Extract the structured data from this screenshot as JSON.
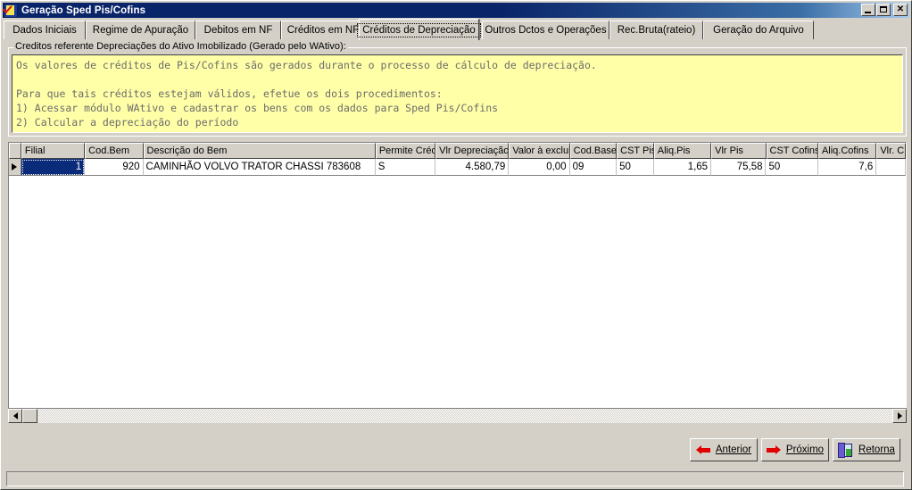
{
  "window": {
    "title": "Geração Sped Pis/Cofins",
    "icon": "checkmark-icon",
    "minimize_label": "_",
    "maximize_label": "□",
    "close_label": "✕"
  },
  "tabs": [
    {
      "label": "Dados Iniciais",
      "active": false
    },
    {
      "label": "Regime de Apuração",
      "active": false
    },
    {
      "label": "Debitos em NF",
      "active": false
    },
    {
      "label": "Créditos em NF",
      "active": false
    },
    {
      "label": "Créditos de Depreciação",
      "active": true
    },
    {
      "label": "Outros Dctos e Operações",
      "active": false
    },
    {
      "label": "Rec.Bruta(rateio)",
      "active": false
    },
    {
      "label": "Geração do Arquivo",
      "active": false
    }
  ],
  "groupbox": {
    "label": "Creditos referente Depreciações do Ativo Imobilizado (Gerado pelo WAtivo):",
    "memo_text": "Os valores de créditos de Pis/Cofins são gerados durante o processo de cálculo de depreciação.\n\nPara que tais créditos estejam válidos, efetue os dois procedimentos:\n1) Acessar módulo WAtivo e cadastrar os bens com os dados para Sped Pis/Cofins\n2) Calcular a depreciação do período",
    "memo_background": "#ffffa8",
    "memo_text_color": "#6b6b6b"
  },
  "grid": {
    "columns": [
      {
        "header": "Filial",
        "align": "right"
      },
      {
        "header": "Cod.Bem",
        "align": "right"
      },
      {
        "header": "Descrição do Bem",
        "align": "left"
      },
      {
        "header": "Permite Créd.",
        "align": "left"
      },
      {
        "header": "Vlr Depreciação",
        "align": "right"
      },
      {
        "header": "Valor à excluir",
        "align": "right"
      },
      {
        "header": "Cod.Base",
        "align": "left"
      },
      {
        "header": "CST Pis",
        "align": "left"
      },
      {
        "header": "Aliq.Pis",
        "align": "right"
      },
      {
        "header": "Vlr Pis",
        "align": "right"
      },
      {
        "header": "CST Cofins",
        "align": "left"
      },
      {
        "header": "Aliq.Cofins",
        "align": "right"
      },
      {
        "header": "Vlr. C",
        "align": "right"
      }
    ],
    "rows": [
      {
        "filial": "1",
        "cod_bem": "920",
        "descricao": "CAMINHÃO VOLVO TRATOR CHASSI 783608",
        "permite_cred": "S",
        "vlr_depreciacao": "4.580,79",
        "valor_excluir": "0,00",
        "cod_base": "09",
        "cst_pis": "50",
        "aliq_pis": "1,65",
        "vlr_pis": "75,58",
        "cst_cofins": "50",
        "aliq_cofins": "7,6",
        "vlr_cofins": "",
        "selected_cell": "filial"
      }
    ],
    "selection_color": "#0a2a7a"
  },
  "buttons": {
    "anterior": {
      "label_pre": "A",
      "label_mnemonic": "A",
      "label": "Anterior",
      "icon": "arrow-left-icon"
    },
    "proximo": {
      "label": "Próximo",
      "icon": "arrow-right-icon"
    },
    "retorna": {
      "label": "Retorna",
      "icon": "door-exit-icon"
    }
  },
  "statusbar": {
    "text": ""
  }
}
